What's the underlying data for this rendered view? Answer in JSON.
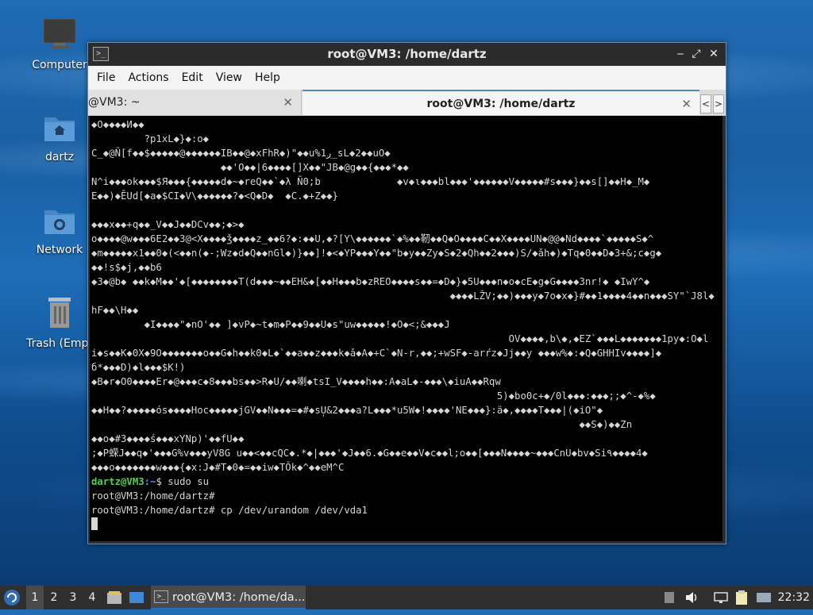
{
  "desktop": {
    "icons": [
      {
        "label": "Computer",
        "icon": "monitor-icon"
      },
      {
        "label": "dartz",
        "icon": "home-folder-icon"
      },
      {
        "label": "Network",
        "icon": "network-folder-icon"
      },
      {
        "label": "Trash (Empt",
        "icon": "trash-icon"
      }
    ]
  },
  "window": {
    "title": "root@VM3: /home/dartz",
    "controls": {
      "minimize": "‒",
      "maximize": "⤢",
      "close": "✕"
    },
    "menu": [
      "File",
      "Actions",
      "Edit",
      "View",
      "Help"
    ],
    "tabs": [
      {
        "label": "@VM3: ~",
        "active": false
      },
      {
        "label": "root@VM3: /home/dartz",
        "active": true
      }
    ],
    "tab_nav": {
      "prev": "<",
      "next": ">"
    }
  },
  "terminal": {
    "garbage_lines": [
      "\u0004O\u0004\u0004\u0004\u0004И\u0004\u0004",
      "         ?p1xL\u0004}\u0004:o\u0004",
      "C_\u0004@Ñ[f\u0004\u0004$\u0004\u0004\u0004\u0004\u0004@\u0004\u0004\u0004\u0004\u0004\u0004IB\u0004\u0004@\u0004xFhR\u0004)\"\u0004\u0004u%1ږ_sL\u00042\u0004\u0004uO\u0004",
      "                      \u0004\u0004'O\u0004\u0004|6\u0004\u0004\u0004\u0004[]X\u0004\u0004\"ЈB\u0004@g\u0004\u0004{\u0004\u0004\u0004*\u0004\u0004",
      "N^i\u0004\u0004\u0004ok\u0004\u0004\u0004$Я\u0004\u0004\u0004{\u0004\u0004\u0004\u0004\u0004d\u0004~\u0004reQ\u0004\u0004`\u0004λ Ñ0;b             \u0004v\u0004ι\u0004\u0004\u0004bl\u0004\u0004\u0004'\u0004\u0004\u0004\u0004\u0004\u0004V\u0004\u0004\u0004\u0004\u0004#s\u0004\u0004\u0004}\u0004\u0004s[]\u0004\u0004H\u0004_M\u0004",
      "E\u0004\u0004)\u0004ĒUd[\u0004a\u0004$CI\u0004V\\\u0004\u0004\u0004\u0004\u0004\u0004?\u0004<Q\u0004D\u0004  \u0004C.\u0004+Z\u0004\u0004}",
      "",
      "\u0004\u0004\u0004x\u0004\u0004+q\u0004\u0004_V\u0004\u0004J\u0004\u0004DCv\u0004\u0004;\u0004>\u0004",
      "o\u0004\u0004\u0004\u0004@w\u0004\u0004\u00046E2\u0004\u00043@<X\u0004\u0004\u0004\u0004ǯ\u0004\u0004\u0004\u0004z_\u0004\u00046?\u0004:\u0004\u0004U,\u0004?[Y\\\u0004\u0004\u0004\u0004\u0004\u0004`\u0004%\u0004\u0004靭\u0004\u0004Q\u0004O\u0004\u0004\u0004\u0004C\u0004\u0004X\u0004\u0004\u0004\u0004UN\u0004@@\u0004Nd\u0004\u0004\u0004\u0004`\u0004\u0004\u0004\u0004\u0004S\u0004^",
      "\u0004m\u0004\u0004\u0004\u0004\u0004x1\u0004\u00040\u0004(<\u0004\u0004n(\u0004-;Wz\u0004d\u0004Q\u0004\u0004nGl\u0004)}\u0004\u0004]!\u0004<\u0004YP\u0004\u0004\u0004Y\u0004\u0004\"b\u0004y\u0004\u0004Zy\u0004S\u00042\u0004Qh\u0004\u00042\u0004\u0004\u0004)S/\u0004ǎh\u0004)\u0004Tq\u00040\u0004\u0004D\u00043+&;c\u0004g\u0004",
      "\u0004\u0004!s$\u0004j,\u0004\u0004b6",
      "\u00043\u0004@b\u0004 \u0004\u0004k\u0004M\u0004\u0004'\u0004[\u0004\u0004\u0004\u0004\u0004\u0004\u0004\u0004T(d\u0004\u0004\u0004~\u0004\u0004EH&\u0004[\u0004\u0004H\u0004\u0004\u0004b\u0004zREO\u0004\u0004\u0004\u0004s\u0004\u0004=\u0004D\u0004}\u00045U\u0004\u0004\u0004n\u0004o\u0004cE\u0004g\u0004G\u0004\u0004\u0004\u0004Зnr!\u0004 \u0004IwY^\u0004",
      "                                                             \u0004\u0004\u0004\u0004LŽV;\u0004\u0004)\u0004\u0004\u0004y\u00047o\u0004x\u0004}#\u0004\u00041\u0004\u0004\u0004\u00044\u0004\u0004n\u0004\u0004\u0004SY\"`J8l\u0004",
      "hF\u0004\u0004\\H\u0004\u0004",
      "         \u0004I\u0004\u0004\u0004\u0004\"\u0004nO'\u0004\u0004 ]\u0004vP\u0004~t\u0004m\u0004P\u0004\u00049\u0004\u0004U\u0004s\"uw\u0004\u0004\u0004\u0004\u0004!\u0004O\u0004<;&\u0004\u0004\u0004J",
      "                                                                       OV\u0004\u0004\u0004\u0004,b\\\u0004,\u0004EZ`\u0004\u0004\u0004L\u0004\u0004\u0004\u0004\u0004\u0004\u00041py\u0004:O\u0004l",
      "i\u0004s\u0004\u0004K\u00040X\u00049O\u0004\u0004\u0004\u0004\u0004\u0004\u0004o\u0004\u0004G\u0004h\u0004\u0004k0\u0004L\u0004`\u0004\u0004a\u0004\u0004z\u0004\u0004\u0004k\u0004ǎ\u0004A\u0004+C`\u0004N-r,\u0004\u0004;+wSF\u0004-arŕz\u0004Jj\u0004\u0004y \u0004\u0004\u0004w%\u0004:\u0004Q\u0004GHHIv\u0004\u0004\u0004\u0004]\u0004",
      "б*\u0004\u0004\u0004D)\u0004l\u0004\u0004\u0004$K!)",
      "\u0004B\u0004r\u0004O0\u0004\u0004\u0004\u0004Er\u0004@\u0004\u0004\u0004c\u00048\u0004\u0004\u0004bs\u0004\u0004>R\u0004U/\u0004\u0004喇\u0004tsI_V\u0004\u0004\u0004\u0004h\u0004\u0004:A\u0004aL\u0004-\u0004\u0004\u0004\\\u0004iuA\u0004\u0004Rqw",
      "                                                                     5)\u0004bo0c+\u0004/0l\u0004\u0004\u0004:\u0004\u0004\u0004;;\u0004^-\u0004%\u0004",
      "\u0004\u0004H\u0004\u0004?\u0004\u0004\u0004\u0004\u0004ós\u0004\u0004\u0004\u0004Hoc\u0004\u0004\u0004\u0004\u0004jGV\u0004\u0004N\u0004\u0004\u0004=\u0004#\u0004sU̩&2\u0004\u0004\u0004a?L\u0004\u0004\u0004*u5W\u0004!\u0004\u0004\u0004\u0004'NE\u0004\u0004\u0004}:ä\u0004,\u0004\u0004\u0004\u0004T\u0004\u0004\u0004|(\u0004iO\"\u0004",
      "                                                                                   \u0004\u0004S\u0004)\u0004\u0004Zn",
      "\u0004\u0004o\u0004#3\u0004\u0004\u0004\u0004ś\u0004\u0004\u0004xYNp)'\u0004\u0004fU\u0004\u0004",
      ";\u0004P蝾J\u0004\u0004q\u0004'\u0004\u0004\u0004G%v\u0004\u0004\u0004yV8G u\u0004\u0004<\u0004\u0004cQC\u0004.*\u0004|\u0004\u0004\u0004'\u0004J\u0004\u00046.\u0004G\u0004\u0004e\u0004\u0004V\u0004c\u0004\u0004l;o\u0004\u0004[\u0004\u0004\u0004N\u0004\u0004\u0004\u0004~\u0004\u0004\u0004CnU\u0004bv\u0004Si٩\u0004\u0004\u0004\u00044\u0004",
      "\u0004\u0004\u0004o\u0004\u0004\u0004\u0004\u0004\u0004\u0004w\u0004\u0004\u0004{\u0004x:J\u0004#T\u00040\u0004=\u0004\u0004iw\u0004TǑk\u0004^\u0004\u0004eM^C"
    ],
    "prompt_user": "dartz@VM3",
    "prompt_path": ":~",
    "cmd1": "$ sudo su",
    "line_root1": "root@VM3:/home/dartz#",
    "line_root2": "root@VM3:/home/dartz# cp /dev/urandom /dev/vda1"
  },
  "taskbar": {
    "workspaces": [
      "1",
      "2",
      "3",
      "4"
    ],
    "active_task": "root@VM3: /home/da...",
    "clock": "22:32"
  },
  "colors": {
    "prompt_user": "#55d055",
    "prompt_path": "#6f8fff",
    "tab_accent": "#4f86c6"
  }
}
